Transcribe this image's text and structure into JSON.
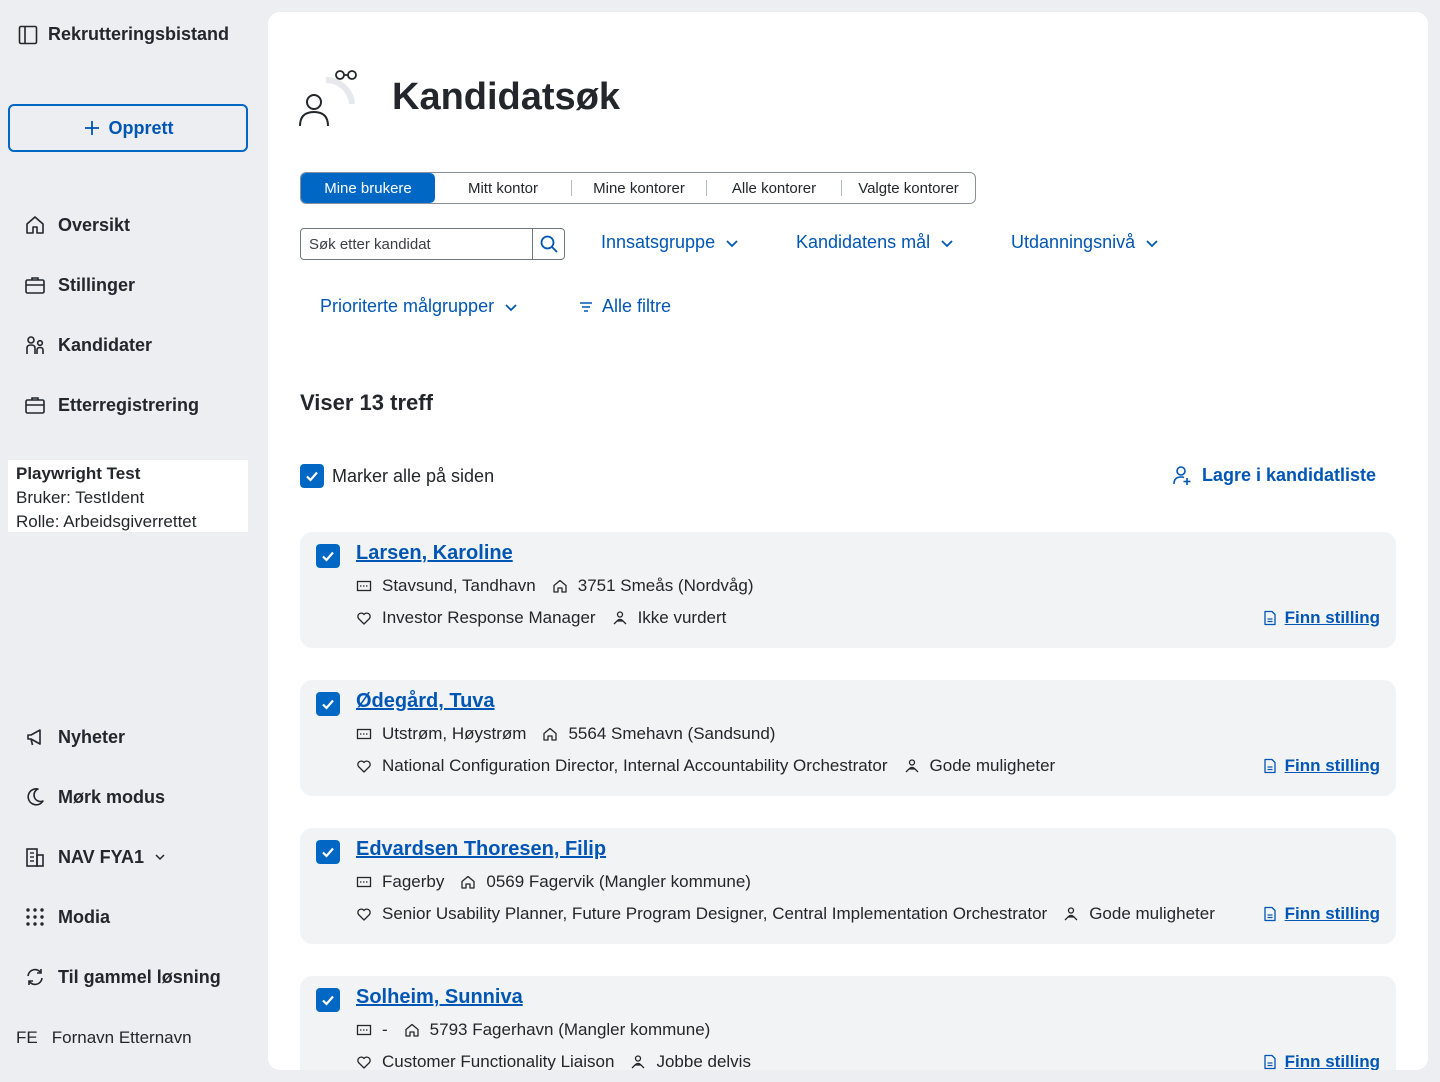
{
  "app": {
    "title": "Rekrutteringsbistand"
  },
  "sidebar": {
    "create_label": "Opprett",
    "nav": [
      {
        "label": "Oversikt",
        "icon": "house-icon"
      },
      {
        "label": "Stillinger",
        "icon": "briefcase-icon"
      },
      {
        "label": "Kandidater",
        "icon": "people-icon"
      },
      {
        "label": "Etterregistrering",
        "icon": "briefcase-icon"
      }
    ],
    "user": {
      "name": "Playwright Test",
      "ident": "Bruker: TestIdent",
      "role": "Rolle: Arbeidsgiverrettet"
    },
    "bottom_nav": [
      {
        "label": "Nyheter",
        "icon": "megaphone-icon"
      },
      {
        "label": "Mørk modus",
        "icon": "moon-icon"
      },
      {
        "label": "NAV FYA1",
        "icon": "buildings-icon"
      },
      {
        "label": "Modia",
        "icon": "grid-icon"
      },
      {
        "label": "Til gammel løsning",
        "icon": "arrows-circle-icon"
      }
    ],
    "avatar_initials": "FE",
    "avatar_name": "Fornavn Etternavn"
  },
  "page": {
    "title": "Kandidatsøk",
    "tabs": [
      "Mine brukere",
      "Mitt kontor",
      "Mine kontorer",
      "Alle kontorer",
      "Valgte kontorer"
    ],
    "active_tab": "Mine brukere",
    "search_placeholder": "Søk etter kandidat",
    "filters": [
      "Innsatsgruppe",
      "Kandidatens mål",
      "Utdanningsnivå",
      "Prioriterte målgrupper"
    ],
    "all_filters": "Alle filtre",
    "hits": "Viser 13 treff",
    "select_all": "Marker alle på siden",
    "save_list": "Lagre i kandidatliste",
    "find_label": "Finn stilling"
  },
  "candidates": [
    {
      "name": "Larsen, Karoline",
      "office": "Stavsund, Tandhavn",
      "address": "3751 Smeås (Nordvåg)",
      "jobs": "Investor Response Manager",
      "status": "Ikke vurdert"
    },
    {
      "name": "Ødegård, Tuva",
      "office": "Utstrøm, Høystrøm",
      "address": "5564 Smehavn (Sandsund)",
      "jobs": "National Configuration Director, Internal Accountability Orchestrator",
      "status": "Gode muligheter"
    },
    {
      "name": "Edvardsen Thoresen, Filip",
      "office": "Fagerby",
      "address": "0569 Fagervik (Mangler kommune)",
      "jobs": "Senior Usability Planner, Future Program Designer, Central Implementation Orchestrator",
      "status": "Gode muligheter"
    },
    {
      "name": "Solheim, Sunniva",
      "office": "-",
      "address": "5793 Fagerhavn (Mangler kommune)",
      "jobs": "Customer Functionality Liaison",
      "status": "Jobbe delvis"
    }
  ],
  "colors": {
    "primary": "#0067c5",
    "link": "#0056b4",
    "sidebar_bg": "#eceef1",
    "card_bg": "#f2f3f5"
  }
}
